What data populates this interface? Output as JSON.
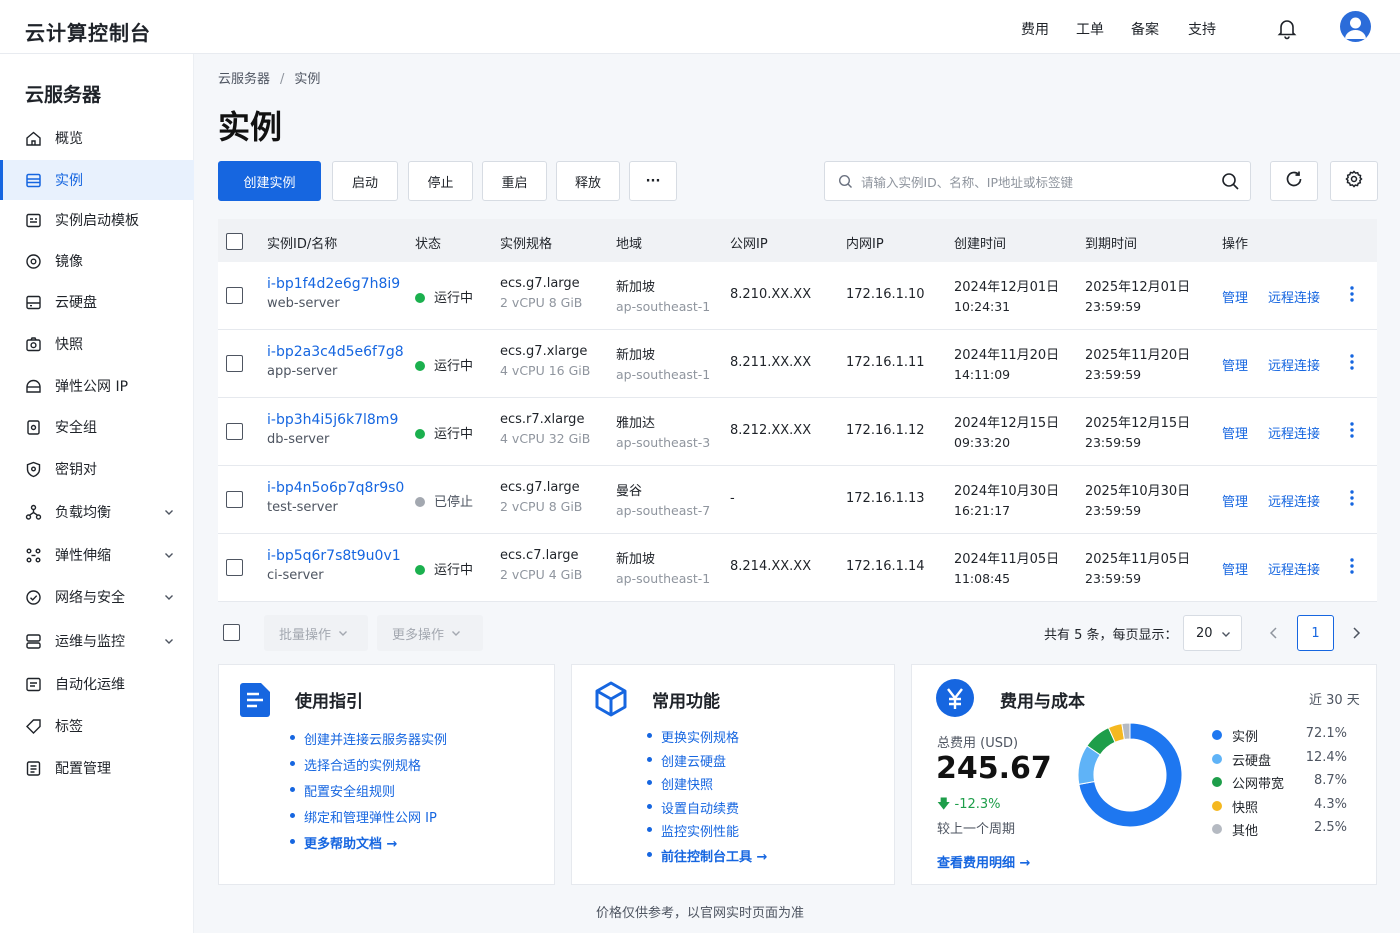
{
  "app": {
    "title": "云计算控制台"
  },
  "topnav": [
    "费用",
    "工单",
    "备案",
    "支持"
  ],
  "sidebar": {
    "title": "云服务器",
    "items": [
      {
        "label": "概览",
        "icon": "home-icon"
      },
      {
        "label": "实例",
        "icon": "server-icon",
        "active": true
      },
      {
        "label": "实例启动模板",
        "icon": "template-icon"
      },
      {
        "label": "镜像",
        "icon": "image-icon"
      },
      {
        "label": "云硬盘",
        "icon": "disk-icon"
      },
      {
        "label": "快照",
        "icon": "snapshot-icon"
      },
      {
        "label": "弹性公网 IP",
        "icon": "ip-icon"
      },
      {
        "label": "安全组",
        "icon": "security-group-icon"
      },
      {
        "label": "密钥对",
        "icon": "key-icon"
      },
      {
        "label": "负载均衡",
        "icon": "load-balance-icon",
        "expandable": true
      },
      {
        "label": "弹性伸缩",
        "icon": "scaling-icon",
        "expandable": true
      },
      {
        "label": "网络与安全",
        "icon": "network-icon",
        "expandable": true
      },
      {
        "label": "运维与监控",
        "icon": "monitor-icon",
        "expandable": true
      },
      {
        "label": "自动化运维",
        "icon": "automation-icon"
      },
      {
        "label": "标签",
        "icon": "tag-icon"
      },
      {
        "label": "配置管理",
        "icon": "config-icon"
      }
    ]
  },
  "breadcrumb": [
    "云服务器",
    "实例"
  ],
  "page": {
    "title": "实例"
  },
  "toolbar": {
    "create": "创建实例",
    "start": "启动",
    "stop": "停止",
    "restart": "重启",
    "release": "释放",
    "more": "···",
    "search_placeholder": "请输入实例ID、名称、IP地址或标签键"
  },
  "table": {
    "headers": [
      "实例ID/名称",
      "状态",
      "实例规格",
      "地域",
      "公网IP",
      "内网IP",
      "创建时间",
      "到期时间",
      "操作"
    ],
    "rows": [
      {
        "id": "i-bp1f4d2e6g7h8i9",
        "name": "web-server",
        "status": "运行中",
        "status_color": "#1bb04e",
        "spec": "ecs.g7.large",
        "spec_detail": "2 vCPU 8 GiB",
        "region": "新加坡",
        "region_code": "ap-southeast-1",
        "public_ip": "8.210.XX.XX",
        "private_ip": "172.16.1.10",
        "created_date": "2024年12月01日",
        "created_time": "10:24:31",
        "expire_date": "2025年12月01日",
        "expire_time": "23:59:59",
        "action1": "管理",
        "action2": "远程连接"
      },
      {
        "id": "i-bp2a3c4d5e6f7g8",
        "name": "app-server",
        "status": "运行中",
        "status_color": "#1bb04e",
        "spec": "ecs.g7.xlarge",
        "spec_detail": "4 vCPU 16 GiB",
        "region": "新加坡",
        "region_code": "ap-southeast-1",
        "public_ip": "8.211.XX.XX",
        "private_ip": "172.16.1.11",
        "created_date": "2024年11月20日",
        "created_time": "14:11:09",
        "expire_date": "2025年11月20日",
        "expire_time": "23:59:59",
        "action1": "管理",
        "action2": "远程连接"
      },
      {
        "id": "i-bp3h4i5j6k7l8m9",
        "name": "db-server",
        "status": "运行中",
        "status_color": "#1bb04e",
        "spec": "ecs.r7.xlarge",
        "spec_detail": "4 vCPU 32 GiB",
        "region": "雅加达",
        "region_code": "ap-southeast-3",
        "public_ip": "8.212.XX.XX",
        "private_ip": "172.16.1.12",
        "created_date": "2024年12月15日",
        "created_time": "09:33:20",
        "expire_date": "2025年12月15日",
        "expire_time": "23:59:59",
        "action1": "管理",
        "action2": "远程连接"
      },
      {
        "id": "i-bp4n5o6p7q8r9s0",
        "name": "test-server",
        "status": "已停止",
        "status_color": "#a3a8b0",
        "spec": "ecs.g7.large",
        "spec_detail": "2 vCPU 8 GiB",
        "region": "曼谷",
        "region_code": "ap-southeast-7",
        "public_ip": "-",
        "private_ip": "172.16.1.13",
        "created_date": "2024年10月30日",
        "created_time": "16:21:17",
        "expire_date": "2025年10月30日",
        "expire_time": "23:59:59",
        "action1": "管理",
        "action2": "远程连接"
      },
      {
        "id": "i-bp5q6r7s8t9u0v1",
        "name": "ci-server",
        "status": "运行中",
        "status_color": "#1bb04e",
        "spec": "ecs.c7.large",
        "spec_detail": "2 vCPU 4 GiB",
        "region": "新加坡",
        "region_code": "ap-southeast-1",
        "public_ip": "8.214.XX.XX",
        "private_ip": "172.16.1.14",
        "created_date": "2024年11月05日",
        "created_time": "11:08:45",
        "expire_date": "2025年11月05日",
        "expire_time": "23:59:59",
        "action1": "管理",
        "action2": "远程连接"
      }
    ]
  },
  "footer_bar": {
    "bulk": "批量操作",
    "more_ops": "更多操作",
    "total": "共有 5 条，每页显示：",
    "page_size": "20",
    "current_page": "1"
  },
  "guide": {
    "title": "使用指引",
    "items": [
      "创建并连接云服务器实例",
      "选择合适的实例规格",
      "配置安全组规则",
      "绑定和管理弹性公网 IP"
    ],
    "more": "更多帮助文档"
  },
  "features": {
    "title": "常用功能",
    "items": [
      "更换实例规格",
      "创建云硬盘",
      "创建快照",
      "设置自动续费",
      "监控实例性能"
    ],
    "more": "前往控制台工具"
  },
  "cost": {
    "title": "费用与成本",
    "range": "近 30 天",
    "total_label": "总费用 (USD)",
    "total_value": "245.67",
    "change": "-12.3%",
    "change_label": "较上一个周期",
    "link": "查看费用明细",
    "breakdown": [
      {
        "name": "实例",
        "percent": 72.1,
        "label": "72.1%",
        "color": "#1e77f0"
      },
      {
        "name": "云硬盘",
        "percent": 12.4,
        "label": "12.4%",
        "color": "#5fb3f7"
      },
      {
        "name": "公网带宽",
        "percent": 8.7,
        "label": "8.7%",
        "color": "#1e9e4a"
      },
      {
        "name": "快照",
        "percent": 4.3,
        "label": "4.3%",
        "color": "#f5b820"
      },
      {
        "name": "其他",
        "percent": 2.5,
        "label": "2.5%",
        "color": "#b5bac2"
      }
    ]
  },
  "footnote": "价格仅供参考，以官网实时页面为准",
  "colors": {
    "accent": "#1666e0",
    "running": "#1bb04e",
    "stopped": "#a3a8b0"
  }
}
